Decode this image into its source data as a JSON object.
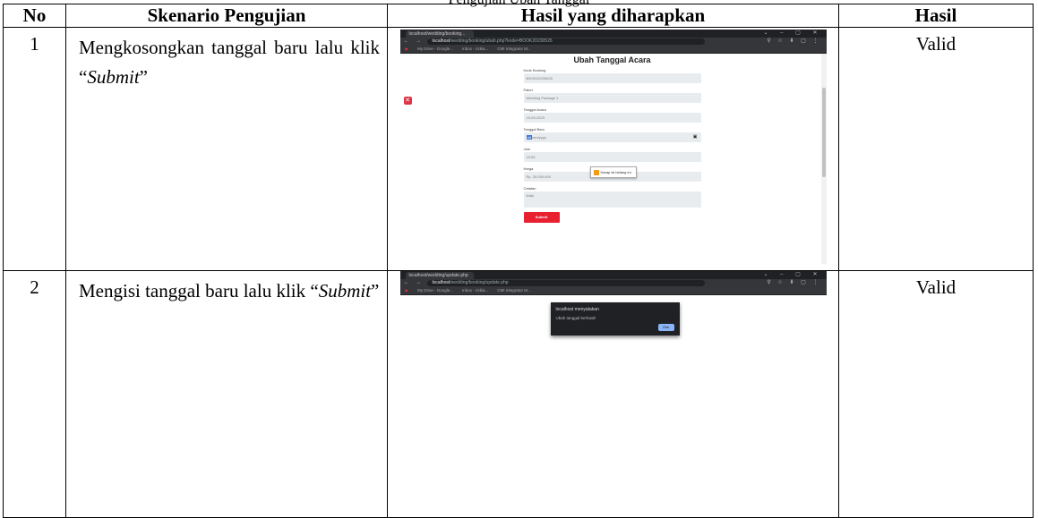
{
  "caption_fragment": "Pengujian Ubah Tanggal",
  "headers": {
    "no": "No",
    "skenario": "Skenario Pengujian",
    "hasil_diharapkan": "Hasil yang diharapkan",
    "hasil": "Hasil"
  },
  "rows": [
    {
      "no": "1",
      "skenario_text": "Mengkosongkan tanggal baru lalu klik “",
      "skenario_em": "Submit",
      "skenario_end": "”",
      "hasil": "Valid",
      "screenshot": {
        "tab_title": "localhost/wedding/booking...",
        "url_host": "localhost",
        "url_path": "/wedding/booking/ubah.php?kode=BOOK20230526",
        "bookmarks": [
          "My Drive - Google...",
          "Inbox - rizkia...",
          "CMI Integrator M..."
        ],
        "form_title": "Ubah Tanggal Acara",
        "fields": [
          {
            "label": "Kode Booking",
            "value": "BOOK20230526",
            "type": "text"
          },
          {
            "label": "Paket",
            "value": "Wedding Package 1",
            "type": "text"
          },
          {
            "label": "Tanggal Acara",
            "value": "19-05-2023",
            "type": "text"
          },
          {
            "label": "Tanggal Baru",
            "value": "mm/yyyy",
            "value_hl": "dd",
            "type": "date"
          },
          {
            "label": "Jam",
            "value": "10:00",
            "type": "text"
          },
          {
            "label": "Harga",
            "value": "Rp. 25.000.000",
            "type": "text"
          },
          {
            "label": "Catatan",
            "value": "tidak",
            "type": "area"
          }
        ],
        "tooltip": "Harap isi bidang ini.",
        "submit_label": "Submit"
      }
    },
    {
      "no": "2",
      "skenario_text": "Mengisi tanggal baru lalu klik “",
      "skenario_em": "Submit",
      "skenario_end": "”",
      "hasil": "Valid",
      "screenshot": {
        "tab_title": "localhost/wedding/update.php",
        "url_host": "localhost",
        "url_path": "/wedding/booking/update.php",
        "bookmarks": [
          "My Drive - Google...",
          "Inbox - rizkia...",
          "CMI Integrator M..."
        ],
        "alert_title": "localhost menyatakan",
        "alert_message": "Ubah tanggal berhasil!",
        "alert_ok": "Oke"
      }
    }
  ]
}
